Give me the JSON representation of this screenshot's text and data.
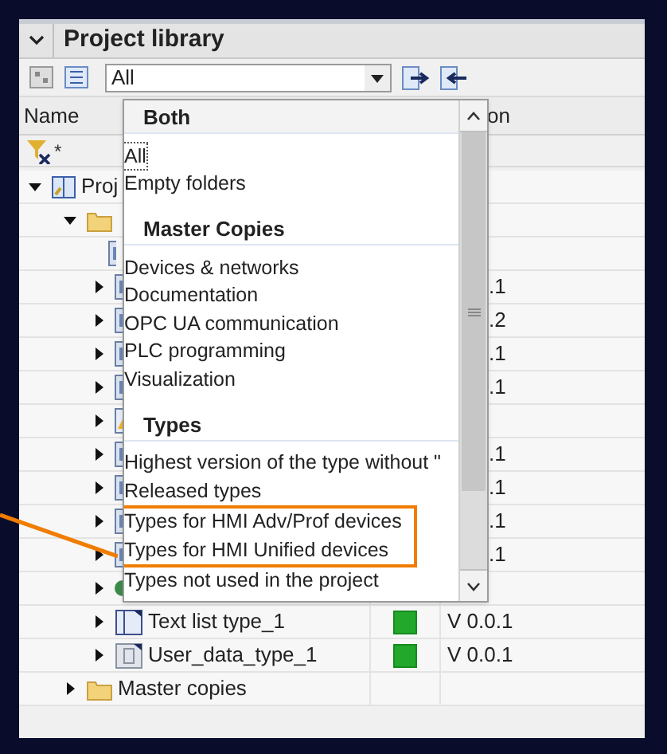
{
  "panel": {
    "title": "Project library",
    "expanded": true
  },
  "toolbar": {
    "filter_value": "All"
  },
  "columns": [
    "Name",
    "on"
  ],
  "filter_row": {
    "text": "*"
  },
  "tree": [
    {
      "label": "Proj",
      "kind": "library",
      "expanded": true,
      "children": [
        {
          "kind": "folder",
          "expanded": true,
          "children": [
            {
              "kind": "block",
              "expandable": false
            },
            {
              "kind": "block",
              "expandable": true,
              "version": ".1"
            },
            {
              "kind": "block",
              "expandable": true,
              "version": ".2"
            },
            {
              "kind": "block",
              "expandable": true,
              "version": ".1"
            },
            {
              "kind": "block",
              "expandable": true,
              "version": ".1"
            },
            {
              "kind": "image",
              "expandable": true
            },
            {
              "kind": "block",
              "expandable": true,
              "version": ".1"
            },
            {
              "kind": "block",
              "expandable": true,
              "version": ".1"
            },
            {
              "kind": "block",
              "expandable": true,
              "version": ".1"
            },
            {
              "kind": "block",
              "expandable": true,
              "version": ".1"
            },
            {
              "kind": "dot",
              "expandable": true
            },
            {
              "label": "Text list type_1",
              "kind": "textlist",
              "expandable": true,
              "released": true,
              "version": "V 0.0.1"
            },
            {
              "label": "User_data_type_1",
              "kind": "datatype",
              "expandable": true,
              "released": true,
              "version": "V 0.0.1"
            }
          ]
        },
        {
          "label": "Master copies",
          "kind": "folder",
          "expanded": false
        }
      ]
    }
  ],
  "dropdown": {
    "groups": [
      {
        "heading": "Both",
        "items": [
          {
            "label": "All",
            "selected": true,
            "highlighted": false
          },
          {
            "label": "Empty folders",
            "selected": false,
            "highlighted": false
          }
        ]
      },
      {
        "heading": "Master Copies",
        "items": [
          {
            "label": "Devices & networks",
            "selected": false,
            "highlighted": false
          },
          {
            "label": "Documentation",
            "selected": false,
            "highlighted": false
          },
          {
            "label": "OPC UA communication",
            "selected": false,
            "highlighted": false
          },
          {
            "label": "PLC programming",
            "selected": false,
            "highlighted": false
          },
          {
            "label": "Visualization",
            "selected": false,
            "highlighted": false
          }
        ]
      },
      {
        "heading": "Types",
        "items": [
          {
            "label": "Highest version of the type without \"",
            "selected": false,
            "highlighted": false
          },
          {
            "label": "Released types",
            "selected": false,
            "highlighted": false
          },
          {
            "label": "Types for HMI Adv/Prof devices",
            "selected": false,
            "highlighted": true
          },
          {
            "label": "Types for HMI Unified devices",
            "selected": false,
            "highlighted": true
          },
          {
            "label": "Types not used in the project",
            "selected": false,
            "highlighted": false
          }
        ]
      }
    ]
  }
}
